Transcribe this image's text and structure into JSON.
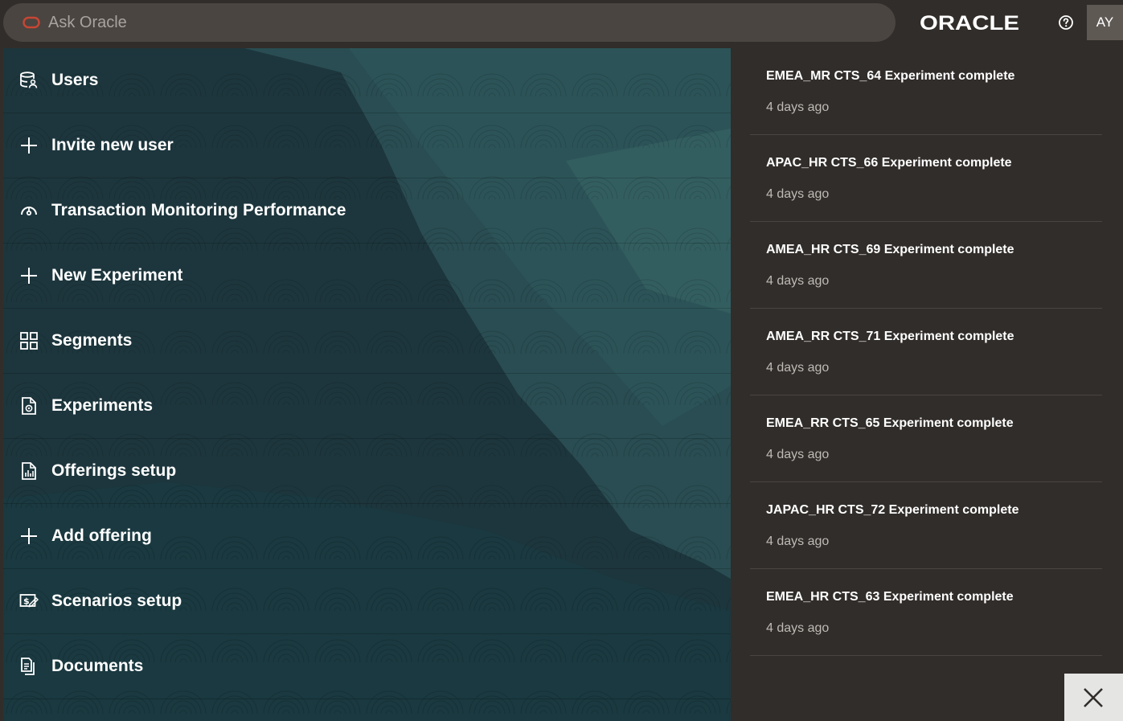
{
  "search": {
    "placeholder": "Ask Oracle"
  },
  "header": {
    "logo_text": "ORACLE",
    "help_icon": "help-icon",
    "avatar_initials": "AY"
  },
  "nav": {
    "items": [
      {
        "label": "Users",
        "icon": "users-database-icon"
      },
      {
        "label": "Invite new user",
        "icon": "plus-icon"
      },
      {
        "label": "Transaction Monitoring Performance",
        "icon": "gauge-icon"
      },
      {
        "label": "New Experiment",
        "icon": "plus-icon"
      },
      {
        "label": "Segments",
        "icon": "grid-icon"
      },
      {
        "label": "Experiments",
        "icon": "document-gear-icon"
      },
      {
        "label": "Offerings setup",
        "icon": "document-chart-icon"
      },
      {
        "label": "Add offering",
        "icon": "plus-icon"
      },
      {
        "label": "Scenarios setup",
        "icon": "money-screen-icon"
      },
      {
        "label": "Documents",
        "icon": "documents-icon"
      }
    ]
  },
  "notifications": [
    {
      "title": "EMEA_MR CTS_64 Experiment complete",
      "time": "4 days ago"
    },
    {
      "title": "APAC_HR CTS_66 Experiment complete",
      "time": "4 days ago"
    },
    {
      "title": "AMEA_HR CTS_69 Experiment complete",
      "time": "4 days ago"
    },
    {
      "title": "AMEA_RR CTS_71 Experiment complete",
      "time": "4 days ago"
    },
    {
      "title": "EMEA_RR CTS_65 Experiment complete",
      "time": "4 days ago"
    },
    {
      "title": "JAPAC_HR CTS_72 Experiment complete",
      "time": "4 days ago"
    },
    {
      "title": "EMEA_HR CTS_63 Experiment complete",
      "time": "4 days ago"
    }
  ],
  "close": {
    "icon": "close-icon"
  },
  "colors": {
    "header_bg": "#312d2a",
    "nav_bg": "#1f3a41",
    "accent_red": "#c74634",
    "text_white": "#ffffff",
    "text_muted": "#bfbab5"
  }
}
